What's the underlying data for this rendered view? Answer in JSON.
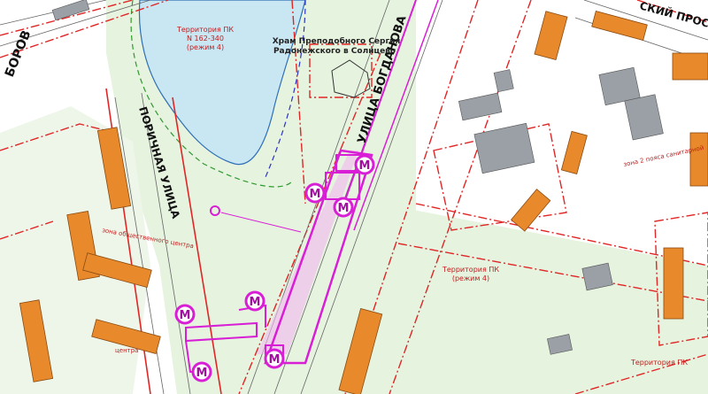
{
  "streets": {
    "borovsk": "БОРОВ",
    "porichnaya": "ПОРИЧНАЯ УЛИЦА",
    "bogdanova": "УЛИЦА БОГДАНОВА",
    "prospect_fragment": "СКИЙ ПРОС"
  },
  "temple": {
    "line1": "Храм Преподобного Сергия",
    "line2": "Радонежского в Солнцево"
  },
  "territories": {
    "pk_pond_line1": "Территория  ПК",
    "pk_pond_line2": "N 162-340",
    "pk_pond_line3": "(режим  4)",
    "pk_mid_line1": "Территория  ПК",
    "pk_mid_line2": "(режим 4)",
    "pk_bottom": "Территория  ПК",
    "zone_right": "зона 2 поясa санитарной",
    "zone_center": "зона общественного центра",
    "zone_left_bottom": "центра"
  },
  "metro_label": "М",
  "colors": {
    "metro": "#d81fd6",
    "red_lines": "#e02626",
    "buildings": "#e88a2c",
    "water": "#c9e6f3",
    "green": "#e6f3df"
  }
}
